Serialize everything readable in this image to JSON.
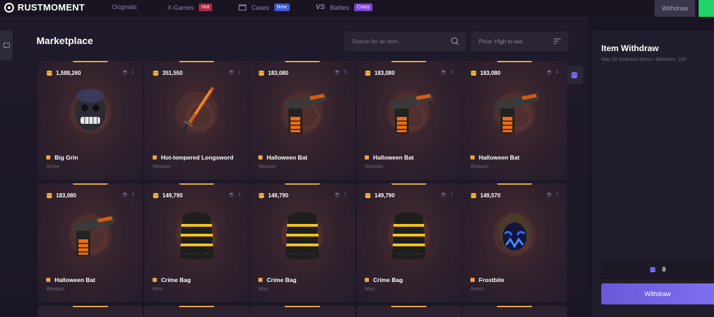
{
  "brand": {
    "logo_text": "RUSTMOMENT"
  },
  "nav": {
    "items": [
      {
        "label": "Originals",
        "badge": ""
      },
      {
        "label": "X-Games",
        "badge": "Hot",
        "badge_color": "#b0284a"
      },
      {
        "label": "Cases",
        "badge": "New",
        "badge_color": "#3d5bd6"
      },
      {
        "label": "Battles",
        "badge": "Crazy",
        "badge_color": "#7b45d8"
      }
    ],
    "withdraw_label": "Withdraw"
  },
  "marketplace": {
    "title": "Marketplace",
    "search_placeholder": "Search for an item...",
    "sort_label": "Price: High to low"
  },
  "items": [
    {
      "price": "1,588,260",
      "qty": "1",
      "name": "Big Grin",
      "type": "Armor",
      "art": "big-grin-mask"
    },
    {
      "price": "351,550",
      "qty": "1",
      "name": "Hot-tempered Longsword",
      "type": "Weapon",
      "art": "longsword"
    },
    {
      "price": "183,080",
      "qty": "5",
      "name": "Halloween Bat",
      "type": "Weapon",
      "art": "halloween-bat"
    },
    {
      "price": "183,080",
      "qty": "3",
      "name": "Halloween Bat",
      "type": "Weapon",
      "art": "halloween-bat"
    },
    {
      "price": "183,080",
      "qty": "4",
      "name": "Halloween Bat",
      "type": "Weapon",
      "art": "halloween-bat"
    },
    {
      "price": "183,080",
      "qty": "4",
      "name": "Halloween Bat",
      "type": "Weapon",
      "art": "halloween-bat"
    },
    {
      "price": "149,790",
      "qty": "1",
      "name": "Crime Bag",
      "type": "Misc",
      "art": "crime-bag"
    },
    {
      "price": "149,790",
      "qty": "1",
      "name": "Crime Bag",
      "type": "Misc",
      "art": "crime-bag"
    },
    {
      "price": "149,790",
      "qty": "1",
      "name": "Crime Bag",
      "type": "Misc",
      "art": "crime-bag"
    },
    {
      "price": "149,570",
      "qty": "1",
      "name": "Frostbite",
      "type": "Armor",
      "art": "frostbite-mask"
    }
  ],
  "withdraw_panel": {
    "title": "Item Withdraw",
    "subtitle": "Max 20 Selected Items • Minimum: 100",
    "total": "0",
    "button_label": "Withdraw"
  },
  "colors": {
    "accent": "#7e6ef0",
    "coin": "#f4b740",
    "rarity": "#f0a03c",
    "green": "#22d36a"
  }
}
